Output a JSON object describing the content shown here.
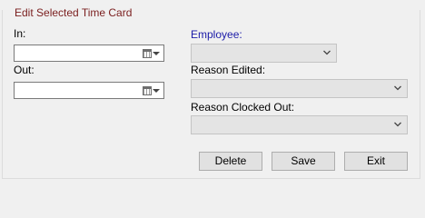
{
  "group": {
    "title": "Edit Selected Time Card"
  },
  "form": {
    "in_label": "In:",
    "in_value": "",
    "out_label": "Out:",
    "out_value": "",
    "employee_label": "Employee:",
    "employee_value": "",
    "reason_edited_label": "Reason Edited:",
    "reason_edited_value": "",
    "reason_clocked_out_label": "Reason Clocked Out:",
    "reason_clocked_out_value": ""
  },
  "buttons": {
    "delete": "Delete",
    "save": "Save",
    "exit": "Exit"
  },
  "icons": {
    "date_picker": "calendar-icon",
    "combo_dropdown": "chevron-down-icon"
  },
  "colors": {
    "group_title": "#7a1e1e",
    "employee_label": "#1c1ca8"
  }
}
